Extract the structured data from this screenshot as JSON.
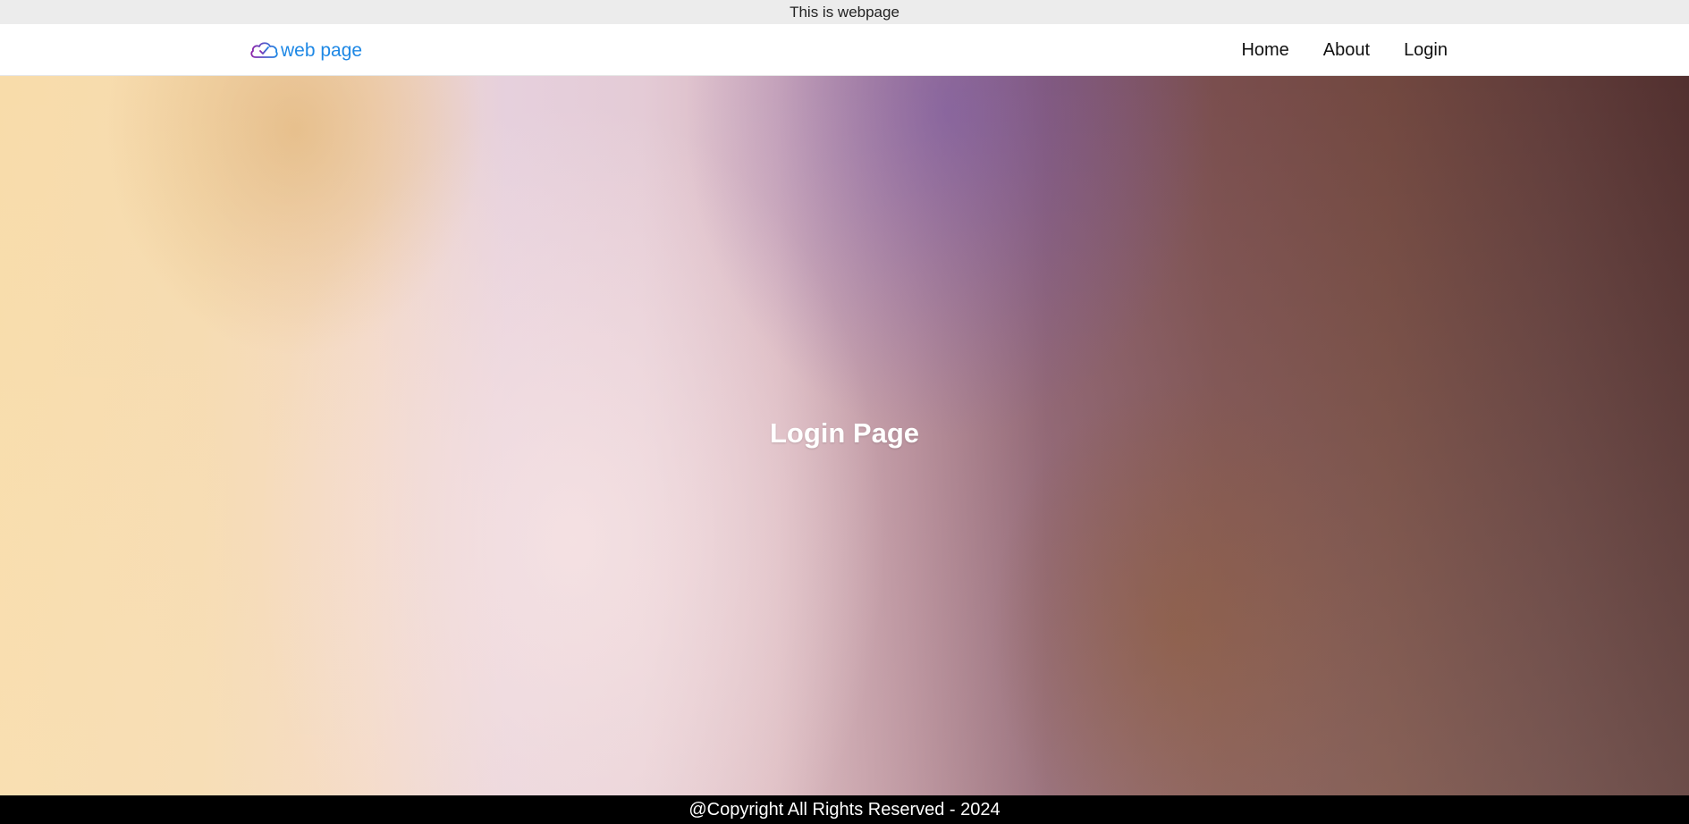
{
  "announcement": {
    "text": "This is webpage"
  },
  "navbar": {
    "brand": {
      "text": "web page",
      "icon": "cloud-check-icon",
      "colors": {
        "text": "#1e88e5",
        "icon_start": "#8e24aa",
        "icon_end": "#1e88e5"
      }
    },
    "links": [
      {
        "label": "Home"
      },
      {
        "label": "About"
      },
      {
        "label": "Login"
      }
    ]
  },
  "hero": {
    "title": "Login Page"
  },
  "footer": {
    "text": "@Copyright All Rights Reserved - 2024"
  }
}
